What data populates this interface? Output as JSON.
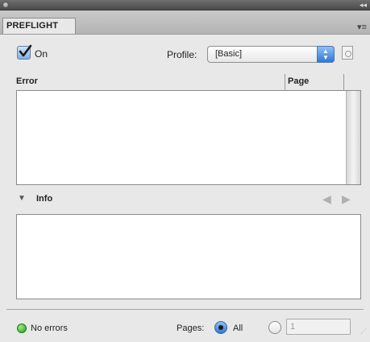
{
  "panel": {
    "tab_title": "PREFLIGHT",
    "on_label": "On",
    "on_checked": true,
    "profile_label": "Profile:",
    "profile_value": "[Basic]"
  },
  "columns": {
    "error": "Error",
    "page": "Page"
  },
  "info": {
    "label": "Info"
  },
  "status": {
    "text": "No errors",
    "color": "#2fae27",
    "pages_label": "Pages:",
    "all_label": "All",
    "range_value": "1"
  }
}
